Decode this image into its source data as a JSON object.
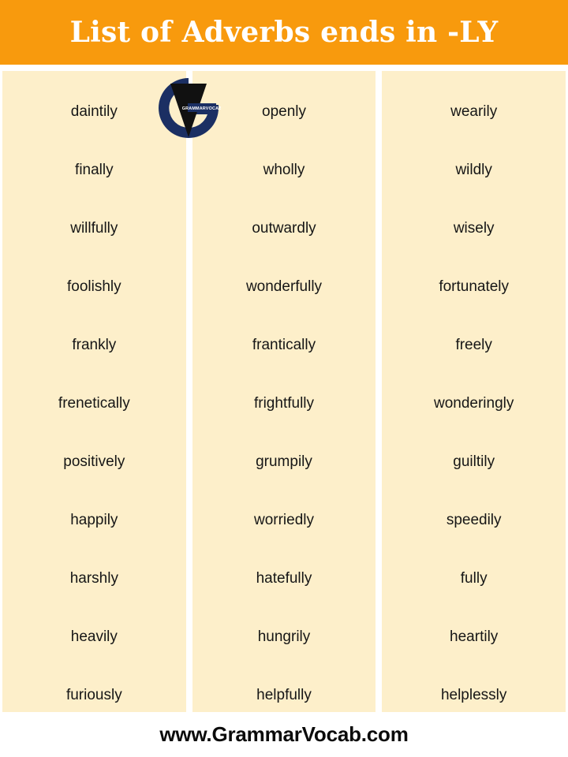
{
  "header": {
    "title": "List of Adverbs ends in -LY",
    "background_color": "#f89a0d",
    "text_color": "#ffffff"
  },
  "logo": {
    "name": "grammarvocab-logo",
    "wordmark": "GRAMMARVOCAB",
    "ring_color": "#1b2f63",
    "v_color": "#111111",
    "band_color": "#1b2f63"
  },
  "board": {
    "panel_color": "#fdefca",
    "word_color": "#161616",
    "columns": [
      {
        "name": "column-1",
        "words": [
          "daintily",
          "finally",
          "willfully",
          "foolishly",
          "frankly",
          "frenetically",
          "positively",
          "happily",
          "harshly",
          "heavily",
          "furiously"
        ]
      },
      {
        "name": "column-2",
        "words": [
          "openly",
          "wholly",
          "outwardly",
          "wonderfully",
          "frantically",
          "frightfully",
          "grumpily",
          "worriedly",
          "hatefully",
          "hungrily",
          "helpfully"
        ]
      },
      {
        "name": "column-3",
        "words": [
          "wearily",
          "wildly",
          "wisely",
          "fortunately",
          "freely",
          "wonderingly",
          "guiltily",
          "speedily",
          "fully",
          "heartily",
          "helplessly"
        ]
      }
    ]
  },
  "footer": {
    "website": "www.GrammarVocab.com"
  }
}
